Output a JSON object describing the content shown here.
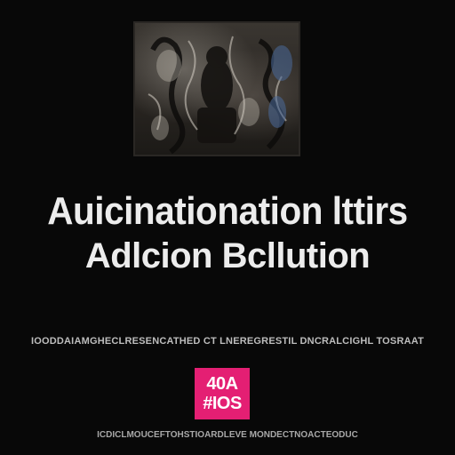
{
  "headline": {
    "line1": "Auicinationation lttirs",
    "line2": "Adlcion Bcllution"
  },
  "caption_top": "IOODDAIAMGHECLRESENCATHED CT LNEREGRESTIL DNCRALCIGHL TOSRAAT",
  "badge": {
    "line1": "40A",
    "line2": "#IOS",
    "color": "#e41f73"
  },
  "caption_bottom": "ICDICLMOUCEFTOHSTIOARDLEVE MONDECTNOACTEODUC",
  "colors": {
    "background": "#080808",
    "headline": "#ececec",
    "accent": "#e41f73"
  }
}
